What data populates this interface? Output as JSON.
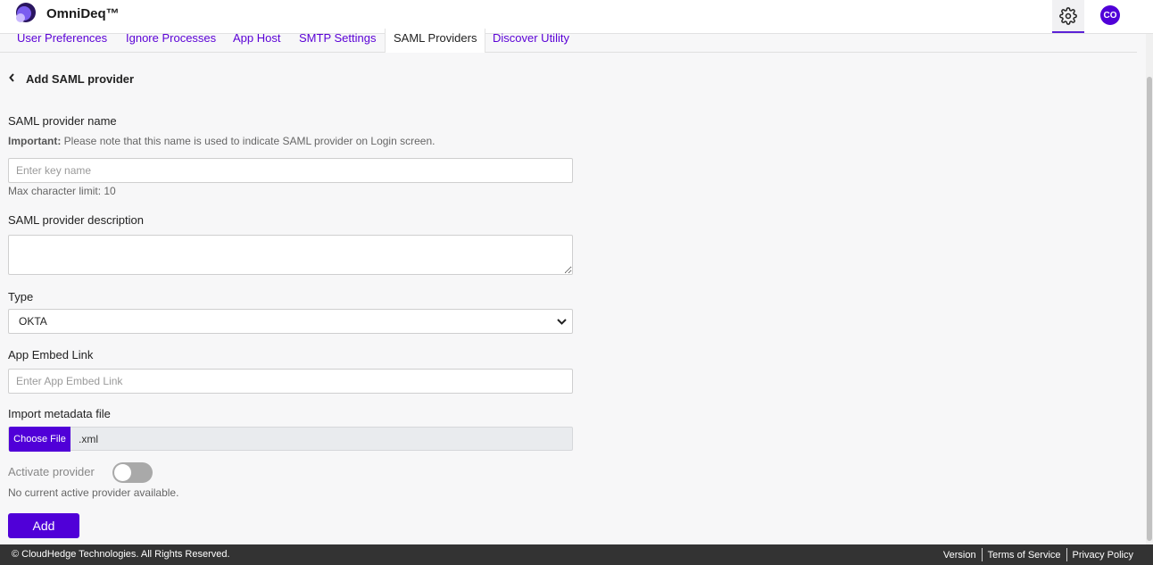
{
  "header": {
    "brand": "OmniDeq™",
    "avatar_initials": "CO",
    "accent": "#5000d8"
  },
  "tabs": [
    {
      "label": "User Preferences",
      "active": false
    },
    {
      "label": "Ignore Processes",
      "active": false
    },
    {
      "label": "App Host",
      "active": false
    },
    {
      "label": "SMTP Settings",
      "active": false
    },
    {
      "label": "SAML Providers",
      "active": true
    },
    {
      "label": "Discover Utility",
      "active": false
    }
  ],
  "form": {
    "title": "Add SAML provider",
    "name_label": "SAML provider name",
    "name_note_strong": "Important:",
    "name_note": " Please note that this name is used to indicate SAML provider on Login screen.",
    "name_placeholder": "Enter key name",
    "name_value": "",
    "name_limit": "Max character limit: 10",
    "desc_label": "SAML provider description",
    "desc_value": "",
    "type_label": "Type",
    "type_value": "OKTA",
    "embed_label": "App Embed Link",
    "embed_placeholder": "Enter App Embed Link",
    "embed_value": "",
    "import_label": "Import metadata file",
    "choose_file": "Choose File",
    "file_ext": ".xml",
    "activate_label": "Activate provider",
    "activate_on": false,
    "activate_note": "No current active provider available.",
    "add_button": "Add"
  },
  "footer": {
    "copyright": "© CloudHedge Technologies. All Rights Reserved.",
    "links": [
      "Version",
      "Terms of Service",
      "Privacy Policy"
    ]
  }
}
